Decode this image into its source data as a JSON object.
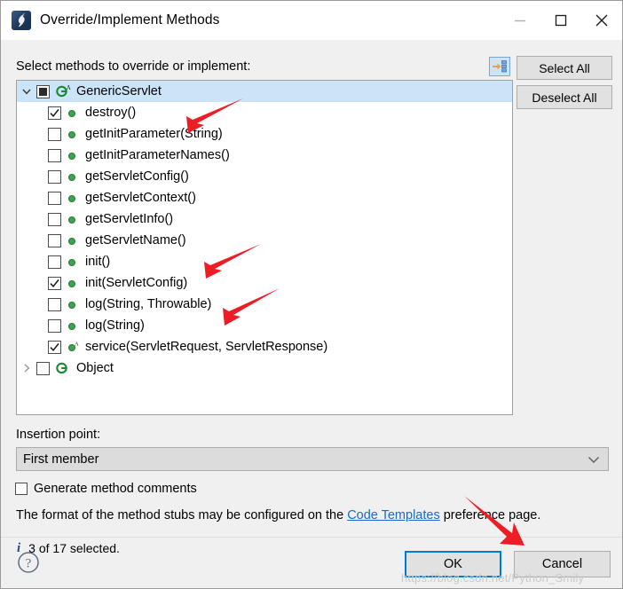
{
  "window": {
    "title": "Override/Implement Methods",
    "icon": "eclipse-java-icon",
    "controls": {
      "minimize": "minimize-icon",
      "maximize": "maximize-icon",
      "close": "close-icon"
    }
  },
  "tree_panel": {
    "caption": "Select methods to override or implement:",
    "link_button_icon": "link-with-editor-icon",
    "items": [
      {
        "label": "GenericServlet",
        "depth": 0,
        "twisty": "chevron-down",
        "check": "partial",
        "icon": "java-class-icon",
        "abstract": true,
        "selected": true
      },
      {
        "label": "destroy()",
        "depth": 1,
        "twisty": "none",
        "check": "checked",
        "icon": "method-public-icon",
        "abstract": false,
        "selected": false
      },
      {
        "label": "getInitParameter(String)",
        "depth": 1,
        "twisty": "none",
        "check": "unchecked",
        "icon": "method-public-icon",
        "abstract": false,
        "selected": false
      },
      {
        "label": "getInitParameterNames()",
        "depth": 1,
        "twisty": "none",
        "check": "unchecked",
        "icon": "method-public-icon",
        "abstract": false,
        "selected": false
      },
      {
        "label": "getServletConfig()",
        "depth": 1,
        "twisty": "none",
        "check": "unchecked",
        "icon": "method-public-icon",
        "abstract": false,
        "selected": false
      },
      {
        "label": "getServletContext()",
        "depth": 1,
        "twisty": "none",
        "check": "unchecked",
        "icon": "method-public-icon",
        "abstract": false,
        "selected": false
      },
      {
        "label": "getServletInfo()",
        "depth": 1,
        "twisty": "none",
        "check": "unchecked",
        "icon": "method-public-icon",
        "abstract": false,
        "selected": false
      },
      {
        "label": "getServletName()",
        "depth": 1,
        "twisty": "none",
        "check": "unchecked",
        "icon": "method-public-icon",
        "abstract": false,
        "selected": false
      },
      {
        "label": "init()",
        "depth": 1,
        "twisty": "none",
        "check": "unchecked",
        "icon": "method-public-icon",
        "abstract": false,
        "selected": false
      },
      {
        "label": "init(ServletConfig)",
        "depth": 1,
        "twisty": "none",
        "check": "checked",
        "icon": "method-public-icon",
        "abstract": false,
        "selected": false
      },
      {
        "label": "log(String, Throwable)",
        "depth": 1,
        "twisty": "none",
        "check": "unchecked",
        "icon": "method-public-icon",
        "abstract": false,
        "selected": false
      },
      {
        "label": "log(String)",
        "depth": 1,
        "twisty": "none",
        "check": "unchecked",
        "icon": "method-public-icon",
        "abstract": false,
        "selected": false
      },
      {
        "label": "service(ServletRequest, ServletResponse)",
        "depth": 1,
        "twisty": "none",
        "check": "checked",
        "icon": "method-public-icon",
        "abstract": true,
        "selected": false
      },
      {
        "label": "Object",
        "depth": 0,
        "twisty": "chevron-right",
        "check": "unchecked",
        "icon": "java-class-icon",
        "abstract": false,
        "selected": false
      }
    ],
    "select_all_label": "Select All",
    "deselect_all_label": "Deselect All"
  },
  "insertion": {
    "label": "Insertion point:",
    "value": "First member",
    "chevron": "chevron-down-icon"
  },
  "generate_comments": {
    "label": "Generate method comments",
    "checked": false
  },
  "hint": {
    "before": "The format of the method stubs may be configured on the ",
    "link": "Code Templates",
    "after": " preference page."
  },
  "status": {
    "icon": "info-icon",
    "text": "3 of 17 selected."
  },
  "footer": {
    "help_icon": "help-icon",
    "ok_label": "OK",
    "cancel_label": "Cancel"
  },
  "watermark": {
    "text": "https://blog.csdn.net/Python_Smily"
  },
  "annotations": {
    "arrow_color": "#ee1c25",
    "arrows": [
      {
        "name": "arrow-to-destroy"
      },
      {
        "name": "arrow-to-init-servletconfig"
      },
      {
        "name": "arrow-to-service"
      },
      {
        "name": "arrow-to-ok-button"
      }
    ]
  },
  "colors": {
    "selection": "#cce4f7",
    "focus_border": "#0078d7",
    "link": "#1b6ac9",
    "method_dot": "#3fa34d",
    "class_icon": "#1a8a32"
  }
}
